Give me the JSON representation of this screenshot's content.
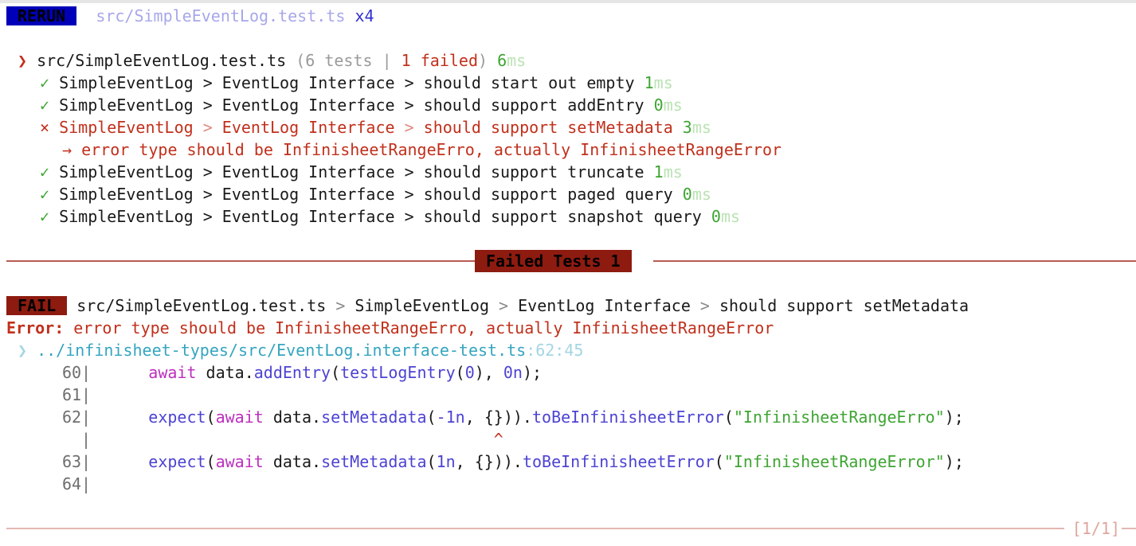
{
  "header": {
    "rerun_label": "RERUN",
    "file": "src/SimpleEventLog.test.ts",
    "count": "x4"
  },
  "suite": {
    "chevron": "❯",
    "file": "src/SimpleEventLog.test.ts",
    "summary_open": "(6 tests | ",
    "failed_count": "1 failed",
    "summary_close": ")",
    "time_num": "6",
    "time_unit": "ms"
  },
  "tests": [
    {
      "mark": "✓",
      "status": "pass",
      "path": "SimpleEventLog > EventLog Interface > should start out empty",
      "time_num": "1",
      "time_unit": "ms"
    },
    {
      "mark": "✓",
      "status": "pass",
      "path": "SimpleEventLog > EventLog Interface > should support addEntry",
      "time_num": "0",
      "time_unit": "ms"
    },
    {
      "mark": "×",
      "status": "fail",
      "suite_name": "SimpleEventLog",
      "sep": " > ",
      "group": "EventLog Interface",
      "name": "should support setMetadata",
      "time_num": "3",
      "time_unit": "ms"
    },
    {
      "mark": "✓",
      "status": "pass",
      "path": "SimpleEventLog > EventLog Interface > should support truncate",
      "time_num": "1",
      "time_unit": "ms"
    },
    {
      "mark": "✓",
      "status": "pass",
      "path": "SimpleEventLog > EventLog Interface > should support paged query",
      "time_num": "0",
      "time_unit": "ms"
    },
    {
      "mark": "✓",
      "status": "pass",
      "path": "SimpleEventLog > EventLog Interface > should support snapshot query",
      "time_num": "0",
      "time_unit": "ms"
    }
  ],
  "error_arrow": "→",
  "error_inline": "error type should be InfinisheetRangeErro, actually InfinisheetRangeError",
  "failed_section": {
    "title": "Failed Tests 1"
  },
  "fail": {
    "badge": "FAIL",
    "file": "src/SimpleEventLog.test.ts",
    "sep": " > ",
    "suite_name": "SimpleEventLog",
    "group": "EventLog Interface",
    "name": "should support setMetadata",
    "error_label": "Error:",
    "error_message": "error type should be InfinisheetRangeErro, actually InfinisheetRangeError",
    "location_chevron": "❯",
    "location_path": "../infinisheet-types/src/EventLog.interface-test.ts",
    "location_pos": ":62:45"
  },
  "code": [
    {
      "num": "60",
      "tokens": [
        [
          "",
          "      "
        ],
        [
          "magenta",
          "await"
        ],
        [
          "",
          " data."
        ],
        [
          "purple",
          "addEntry"
        ],
        [
          "",
          "("
        ],
        [
          "purple",
          "testLogEntry"
        ],
        [
          "",
          "("
        ],
        [
          "purple",
          "0"
        ],
        [
          "",
          "), "
        ],
        [
          "purple",
          "0n"
        ],
        [
          "",
          ");"
        ]
      ]
    },
    {
      "num": "61",
      "tokens": []
    },
    {
      "num": "62",
      "tokens": [
        [
          "",
          "      "
        ],
        [
          "purple",
          "expect"
        ],
        [
          "",
          "("
        ],
        [
          "magenta",
          "await"
        ],
        [
          "",
          " data."
        ],
        [
          "purple",
          "setMetadata"
        ],
        [
          "",
          "("
        ],
        [
          "purple",
          "-1n"
        ],
        [
          "",
          ", {}))."
        ],
        [
          "purple",
          "toBeInfinisheetError"
        ],
        [
          "",
          "("
        ],
        [
          "str",
          "\"InfinisheetRangeErro\""
        ],
        [
          "",
          ");"
        ]
      ]
    },
    {
      "num": "",
      "tokens": [
        [
          "",
          "                                          "
        ],
        [
          "red",
          "^"
        ]
      ]
    },
    {
      "num": "63",
      "tokens": [
        [
          "",
          "      "
        ],
        [
          "purple",
          "expect"
        ],
        [
          "",
          "("
        ],
        [
          "magenta",
          "await"
        ],
        [
          "",
          " data."
        ],
        [
          "purple",
          "setMetadata"
        ],
        [
          "",
          "("
        ],
        [
          "purple",
          "1n"
        ],
        [
          "",
          ", {}))."
        ],
        [
          "purple",
          "toBeInfinisheetError"
        ],
        [
          "",
          "("
        ],
        [
          "str",
          "\"InfinisheetRangeError\""
        ],
        [
          "",
          ");"
        ]
      ]
    },
    {
      "num": "64",
      "tokens": []
    }
  ],
  "footer": {
    "pager": "[1/1]"
  }
}
